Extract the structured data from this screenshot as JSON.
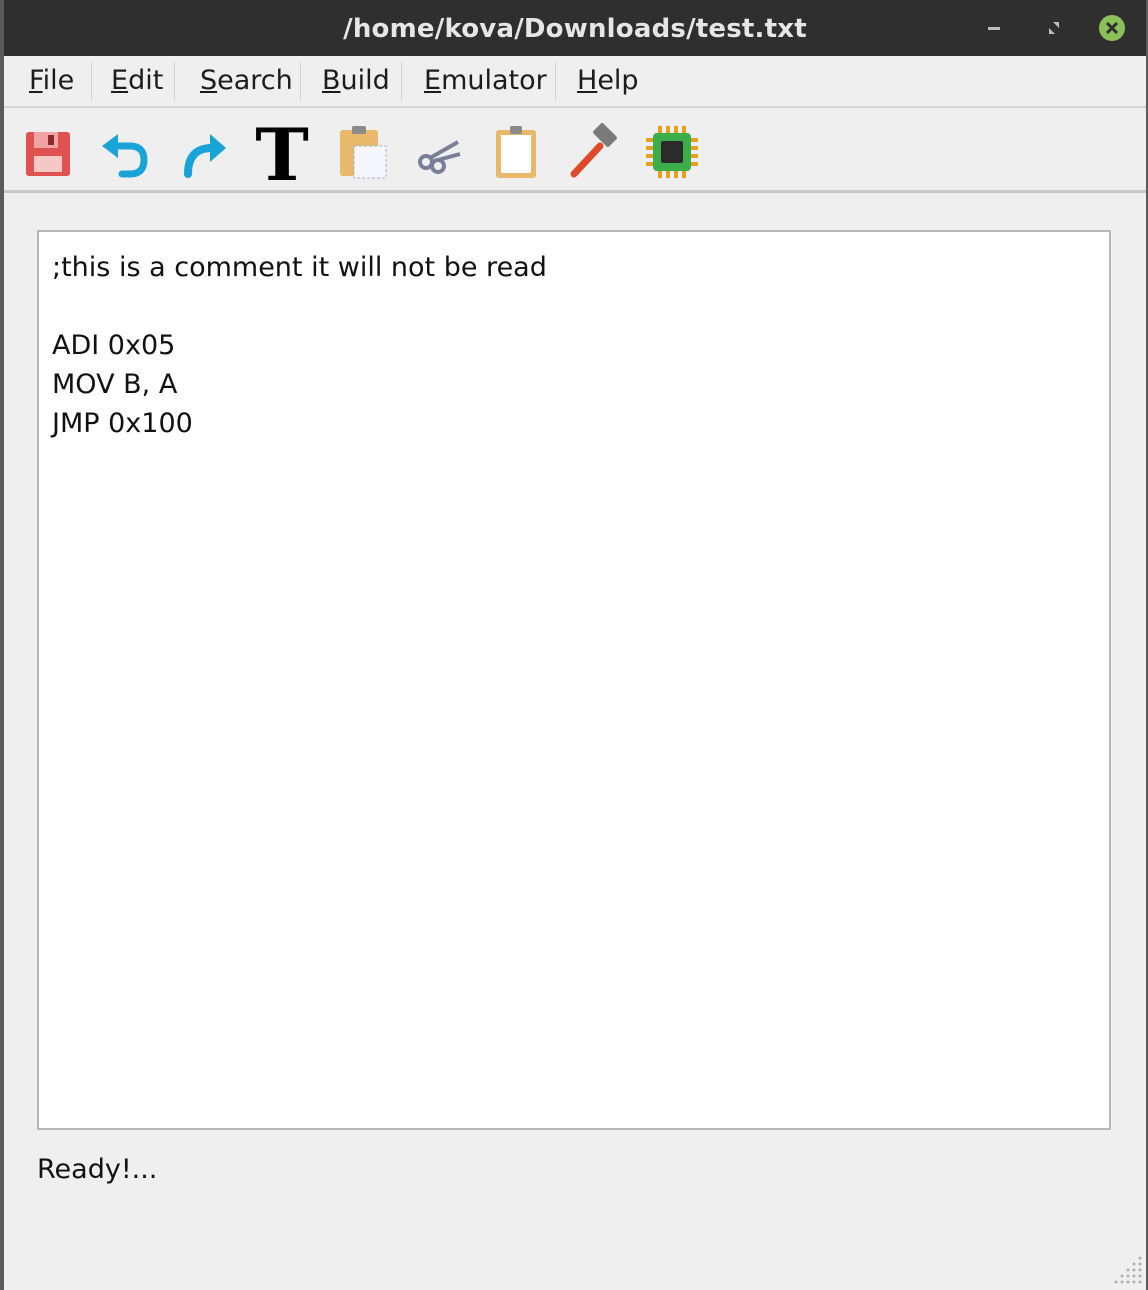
{
  "window": {
    "title": "/home/kova/Downloads/test.txt",
    "title_color": "#2f2f2f",
    "close_color": "#8bbf5a"
  },
  "menubar": {
    "items": [
      {
        "mnemonic": "F",
        "rest": "ile"
      },
      {
        "mnemonic": "E",
        "rest": "dit"
      },
      {
        "mnemonic": "S",
        "rest": "earch"
      },
      {
        "mnemonic": "B",
        "rest": "uild"
      },
      {
        "mnemonic": "E",
        "rest": "mulator"
      },
      {
        "mnemonic": "H",
        "rest": "elp"
      }
    ]
  },
  "toolbar": {
    "buttons": [
      {
        "icon": "save-icon"
      },
      {
        "icon": "undo-icon"
      },
      {
        "icon": "redo-icon"
      },
      {
        "icon": "font-icon"
      },
      {
        "icon": "paste-icon"
      },
      {
        "icon": "cut-icon"
      },
      {
        "icon": "clipboard-icon"
      },
      {
        "icon": "build-hammer-icon"
      },
      {
        "icon": "chip-emulator-icon"
      }
    ]
  },
  "editor": {
    "lines": [
      ";this is a comment it will not be read",
      "",
      "ADI 0x05",
      "MOV B, A",
      "JMP 0x100"
    ]
  },
  "status": {
    "text": "Ready!..."
  }
}
